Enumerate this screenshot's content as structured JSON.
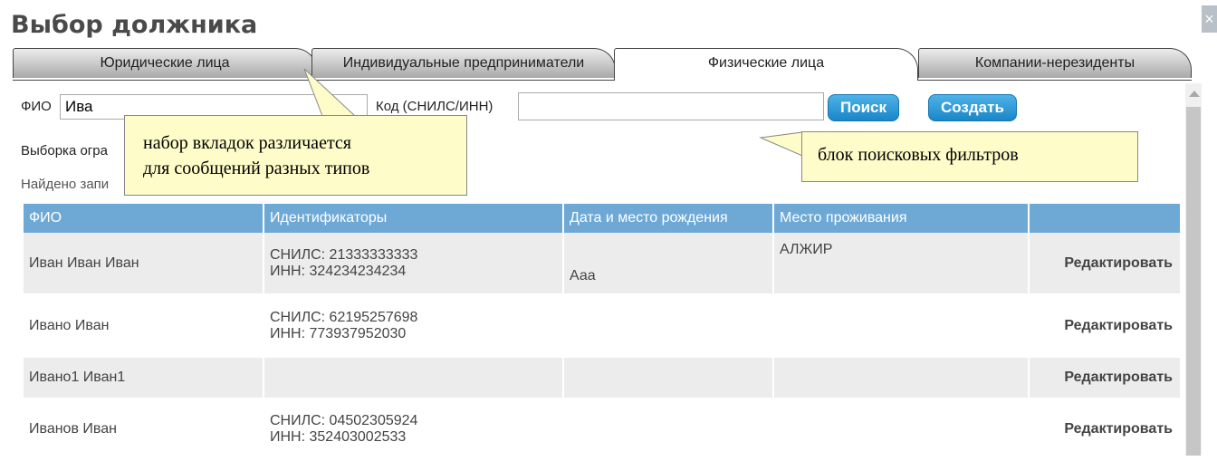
{
  "dialog": {
    "title": "Выбор должника",
    "close_label": "×"
  },
  "tabs": [
    {
      "label": "Юридические лица",
      "active": false
    },
    {
      "label": "Индивидуальные предприниматели",
      "active": false
    },
    {
      "label": "Физические лица",
      "active": true
    },
    {
      "label": "Компании-нерезиденты",
      "active": false
    }
  ],
  "filters": {
    "fio_label": "ФИО",
    "fio_value": "Ива",
    "code_label": "Код (СНИЛС/ИНН)",
    "code_value": "",
    "search_button": "Поиск",
    "create_button": "Создать"
  },
  "info": {
    "limit_text": "Выборка огра",
    "found_text": "Найдено запи"
  },
  "table": {
    "headers": [
      "ФИО",
      "Идентификаторы",
      "Дата и место рождения",
      "Место проживания",
      ""
    ],
    "rows": [
      {
        "fio": "Иван Иван Иван",
        "snils": "СНИЛС: 21333333333",
        "inn": "ИНН: 324234234234",
        "birth": "Ааа",
        "residence": "АЛЖИР",
        "action": "Редактировать"
      },
      {
        "fio": "Ивано Иван",
        "snils": "СНИЛС: 62195257698",
        "inn": "ИНН: 773937952030",
        "birth": "",
        "residence": "",
        "action": "Редактировать"
      },
      {
        "fio": "Ивано1 Иван1",
        "snils": "",
        "inn": "",
        "birth": "",
        "residence": "",
        "action": "Редактировать"
      },
      {
        "fio": "Иванов Иван",
        "snils": "СНИЛС: 04502305924",
        "inn": "ИНН: 352403002533",
        "birth": "",
        "residence": "",
        "action": "Редактировать"
      }
    ]
  },
  "callouts": {
    "tabs_note_line1": "набор вкладок различается",
    "tabs_note_line2": "для сообщений разных типов",
    "filters_note": "блок поисковых фильтров"
  },
  "colors": {
    "accent": "#1a86c8",
    "header_bg": "#6ea9d6",
    "callout_bg": "#fefcc8"
  }
}
